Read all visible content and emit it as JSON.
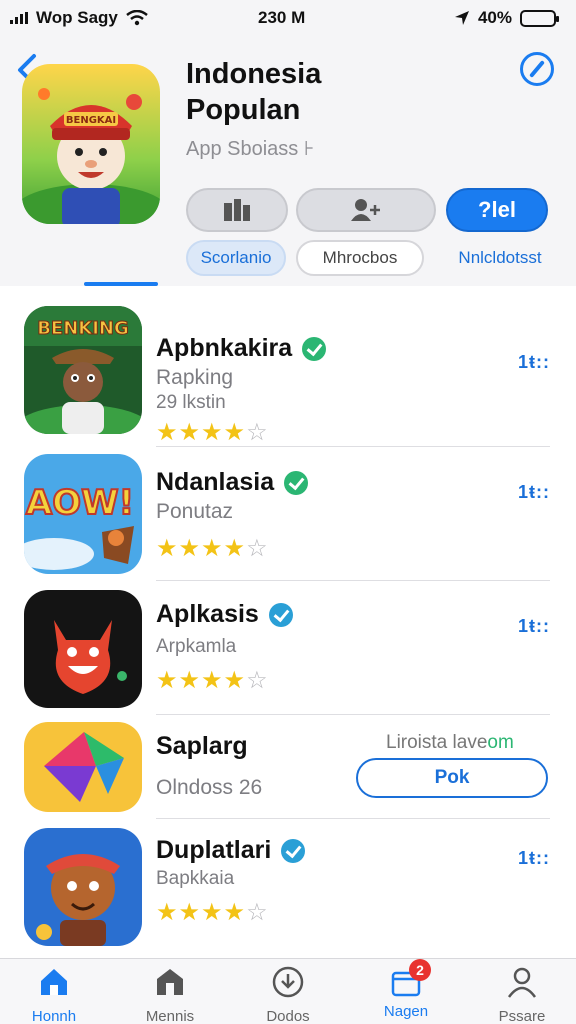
{
  "status_bar": {
    "carrier": "Wop Sagy",
    "time": "230 M",
    "battery": "40%"
  },
  "header": {
    "title_line1": "Indonesia",
    "title_line2": "Populan",
    "subtitle": "App Sboiass ⊦",
    "pills": [
      "Scorlanio",
      "Mhrocbos",
      "Nnlcldotsst"
    ],
    "primary_button": "?lel",
    "app_icon_text": "BENGKAI"
  },
  "apps": [
    {
      "name": "Apbnkakira",
      "category": "Rapking",
      "meta": "29 lkstin",
      "rating": 4,
      "action": "more",
      "icon_text": "BENKING",
      "verified": "green"
    },
    {
      "name": "Ndanlasia",
      "category": "Ponutaz",
      "meta": "",
      "rating": 4,
      "action": "more",
      "icon_text": "AOW!",
      "verified": "green"
    },
    {
      "name": "Aplkasis",
      "category": "Arpkamla",
      "meta": "",
      "rating": 4,
      "action": "more",
      "icon_text": "",
      "verified": "blue"
    },
    {
      "name": "Saplarg",
      "category": "Olndoss 26",
      "meta": "",
      "rating": 0,
      "action": "get",
      "get_label": "Pok",
      "note": "Liroista lave",
      "note_accent": "om",
      "icon_text": "",
      "verified": ""
    },
    {
      "name": "Duplatlari",
      "category": "Bapkkaia",
      "meta": "",
      "rating": 4,
      "action": "more",
      "icon_text": "",
      "verified": "blue"
    }
  ],
  "more_label": "1ŧ::",
  "tabs": [
    {
      "label": "Honnh",
      "icon": "home-icon",
      "active": true
    },
    {
      "label": "Mennis",
      "icon": "store-icon",
      "active": false
    },
    {
      "label": "Dodos",
      "icon": "download-icon",
      "active": false
    },
    {
      "label": "Nagen",
      "icon": "updates-icon",
      "active": false,
      "badge": "2"
    },
    {
      "label": "Pssare",
      "icon": "profile-icon",
      "active": false
    }
  ],
  "colors": {
    "accent": "#1a7cf0",
    "star": "#f3c316",
    "badge": "#e8332f",
    "verified": "#2bb673"
  }
}
